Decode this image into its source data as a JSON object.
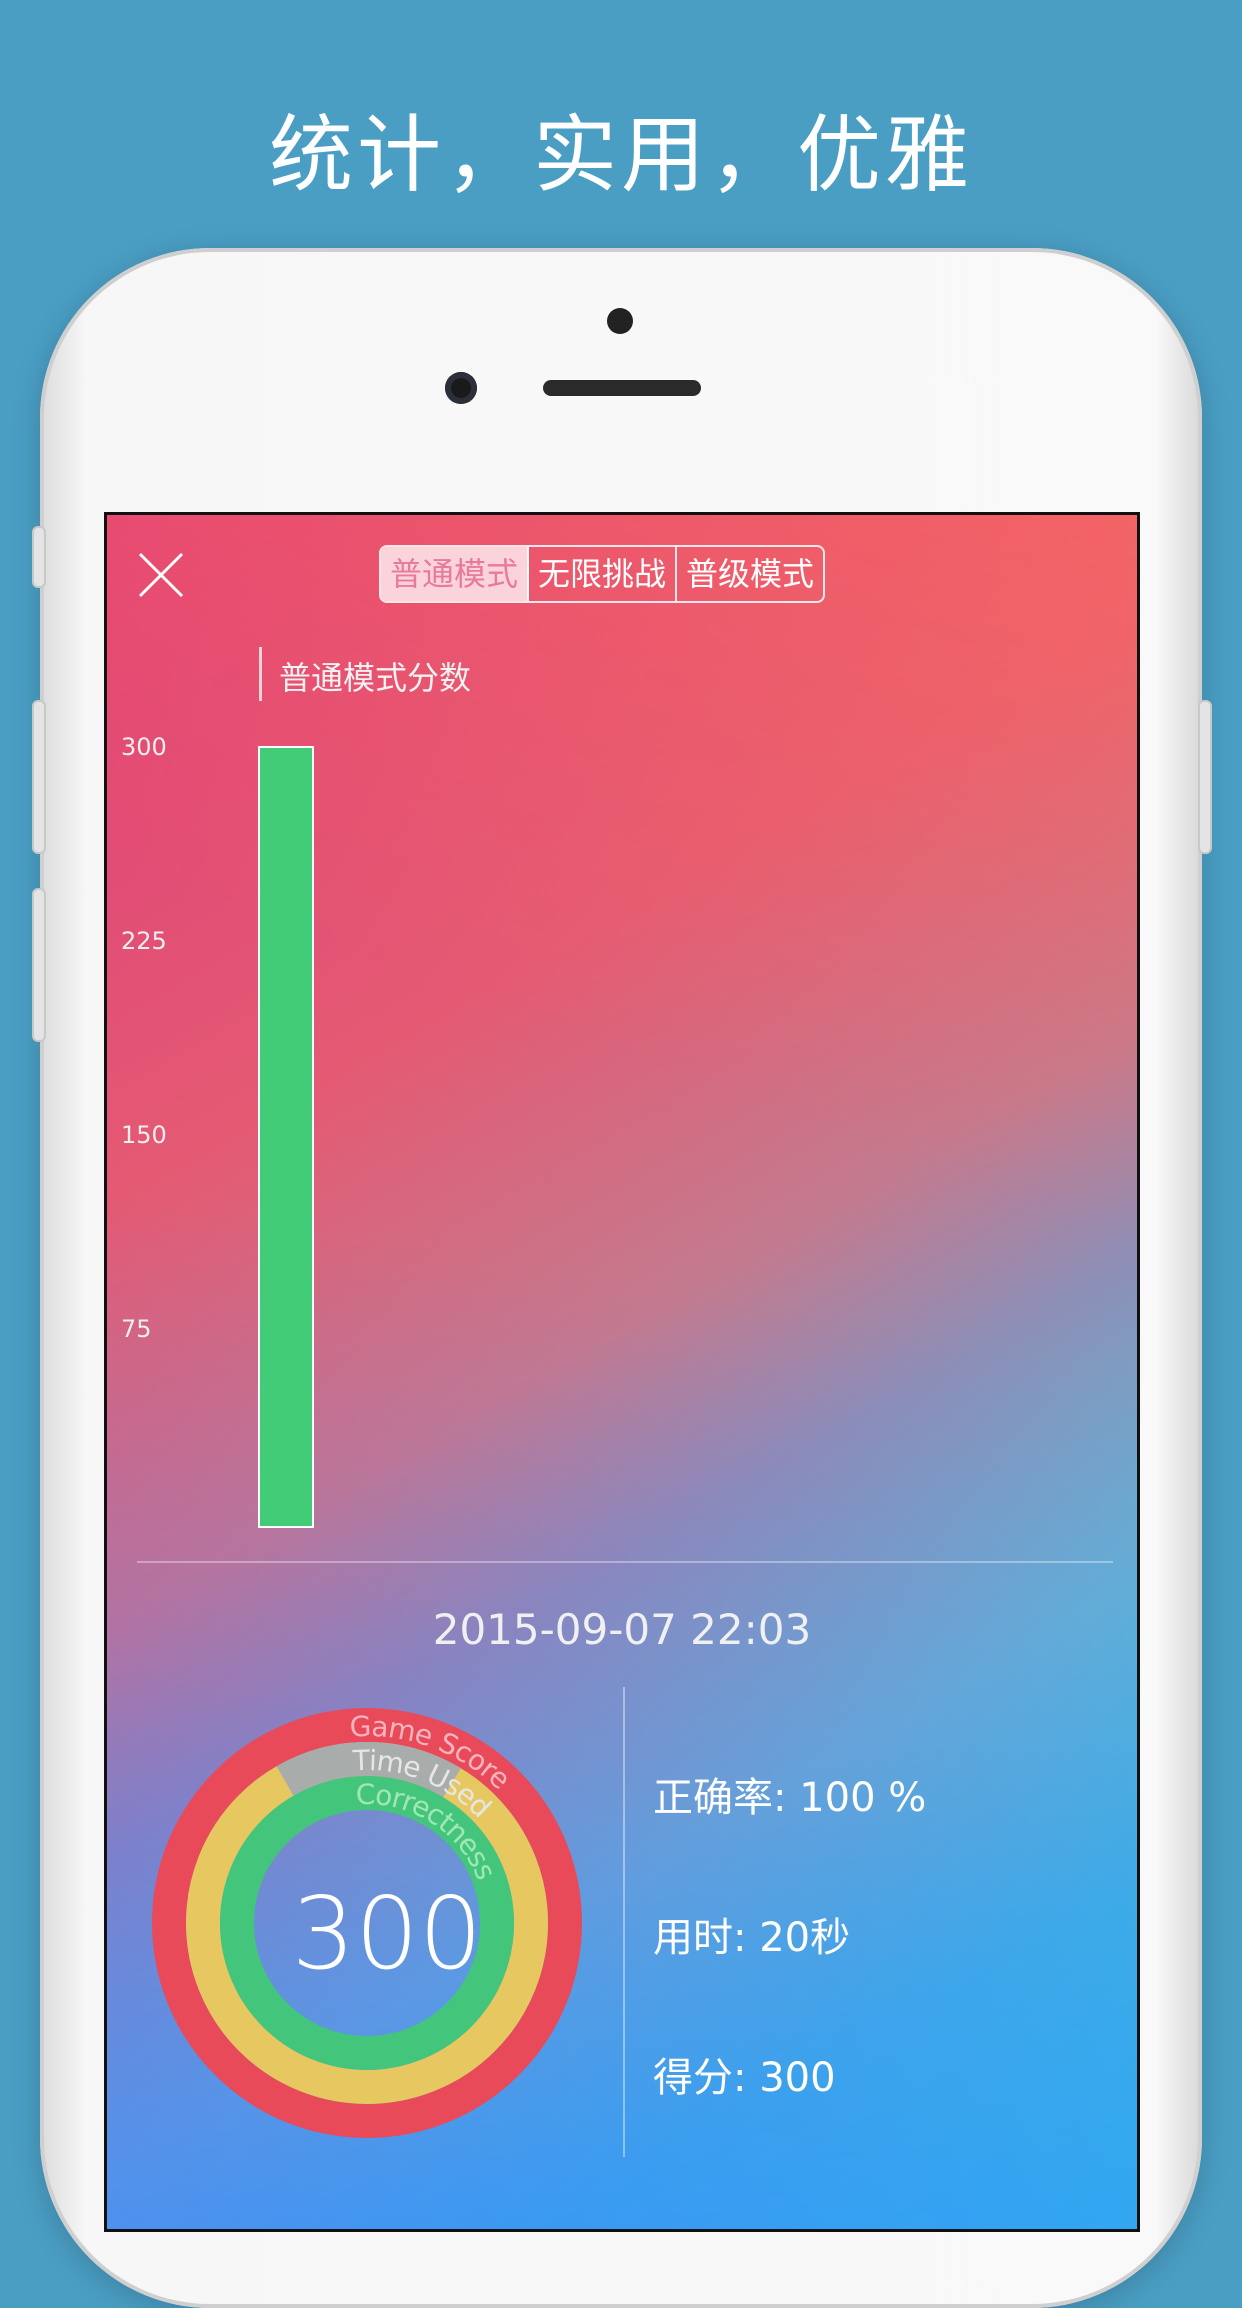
{
  "headline": "统计，实用，优雅",
  "tabs": [
    {
      "label": "普通模式",
      "active": true
    },
    {
      "label": "无限挑战",
      "active": false
    },
    {
      "label": "普级模式",
      "active": false
    }
  ],
  "colors": {
    "bar_green": "#43cc78",
    "ring_red": "#e84a5a",
    "ring_yellow": "#e7c860",
    "ring_grey": "#a8acab",
    "ring_green": "#43c57c"
  },
  "chart_data": {
    "type": "bar",
    "title": "普通模式分数",
    "yticks": [
      "300",
      "225",
      "150",
      "75"
    ],
    "ylim": [
      0,
      300
    ],
    "values": [
      300
    ]
  },
  "session": {
    "datetime": "2015-09-07   22:03"
  },
  "rings": {
    "labels": [
      "Game Score",
      "Time Used",
      "Correctness"
    ],
    "score": "300",
    "time_used_fraction": 0.83
  },
  "stats": {
    "correctness": "正确率: 100 %",
    "time_used": "用时: 20秒",
    "score": "得分: 300"
  }
}
